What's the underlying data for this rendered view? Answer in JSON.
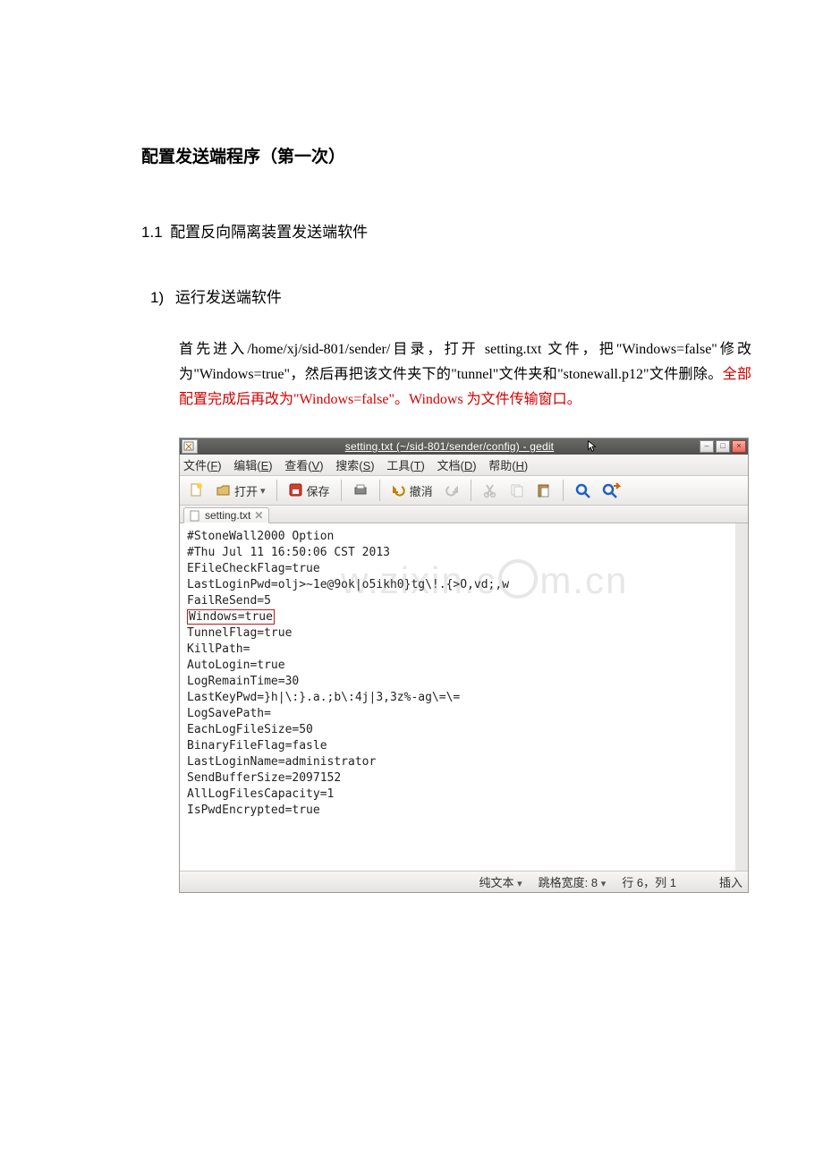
{
  "doc": {
    "title": "配置发送端程序（第一次）",
    "section_num": "1.1",
    "section_text": "配置反向隔离装置发送端软件",
    "item_num": "1)",
    "item_text": "运行发送端软件",
    "para_before_red": "首先进入/home/xj/sid-801/sender/目录，打开 setting.txt 文件，把\"Windows=false\"修改为\"Windows=true\"，然后再把该文件夹下的\"tunnel\"文件夹和\"stonewall.p12\"文件删除。",
    "para_red": "全部配置完成后再改为\"Windows=false\"。Windows 为文件传输窗口。"
  },
  "gedit": {
    "title": "setting.txt (~/sid-801/sender/config) - gedit",
    "menu": {
      "file": "文件(F)",
      "edit": "编辑(E)",
      "view": "查看(V)",
      "search": "搜索(S)",
      "tools": "工具(T)",
      "docs": "文档(D)",
      "help": "帮助(H)"
    },
    "toolbar": {
      "open": "打开",
      "save": "保存",
      "undo": "撤消"
    },
    "tab_label": "setting.txt",
    "content": {
      "l1": "#StoneWall2000 Option",
      "l2": "#Thu Jul 11 16:50:06 CST 2013",
      "l3": "EFileCheckFlag=true",
      "l4": "LastLoginPwd=olj>~1e@9ok|o5ikh0}tg\\!.{>O,vd;,w",
      "l5": "FailReSend=5",
      "l6": "Windows=true",
      "l7": "TunnelFlag=true",
      "l8": "KillPath=",
      "l9": "AutoLogin=true",
      "l10": "LogRemainTime=30",
      "l11": "LastKeyPwd=}h|\\:}.a.;b\\:4j|3,3z%-ag\\=\\=",
      "l12": "LogSavePath=",
      "l13": "EachLogFileSize=50",
      "l14": "BinaryFileFlag=fasle",
      "l15": "LastLoginName=administrator",
      "l16": "SendBufferSize=2097152",
      "l17": "AllLogFilesCapacity=1",
      "l18": "IsPwdEncrypted=true"
    },
    "status": {
      "syntax": "纯文本",
      "tabwidth_label": "跳格宽度:",
      "tabwidth_val": "8",
      "pos": "行 6，列 1",
      "mode": "插入"
    }
  },
  "watermark": "w.zixin.com.cn"
}
